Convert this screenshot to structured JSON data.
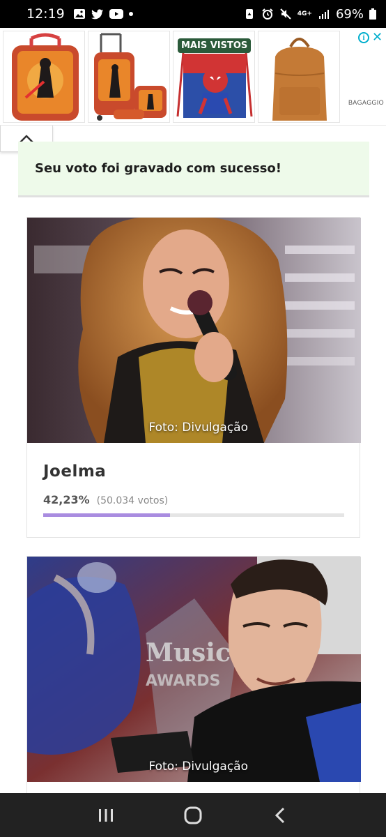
{
  "status_bar": {
    "time": "12:19",
    "battery": "69%",
    "network": "4G+",
    "left_icons": [
      "gallery-icon",
      "twitter-icon",
      "youtube-icon",
      "notification-dot"
    ],
    "right_icons": [
      "recycle-icon",
      "alarm-icon",
      "mute-icon",
      "signal-icon",
      "battery-icon"
    ]
  },
  "ad": {
    "tag": "MAIS VISTOS",
    "brand": "BAGAGGIO",
    "info_symbol": "i",
    "close_symbol": "✕",
    "items": [
      "backpack-star-wars",
      "trolley-set-star-wars",
      "spiderman-bag",
      "leather-backpack"
    ]
  },
  "success_message": "Seu voto foi gravado com sucesso!",
  "cards": [
    {
      "name": "Joelma",
      "caption": "Foto: Divulgação",
      "percent": "42,23%",
      "votes": "(50.034 votos)",
      "progress": 0.4223
    },
    {
      "caption": "Foto: Divulgação"
    }
  ],
  "colors": {
    "success_bg": "#eefaea",
    "progress_fill": "#a98ce0",
    "ad_accent": "#00aecd",
    "tag_bg": "#2b5a3a"
  }
}
